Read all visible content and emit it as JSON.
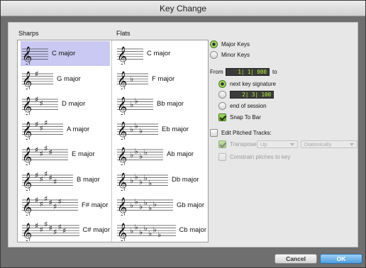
{
  "window": {
    "title": "Key Change"
  },
  "lists": {
    "sharps_header": "Sharps",
    "flats_header": "Flats",
    "sharps": [
      {
        "label": "C major",
        "accidentals": 0,
        "selected": true
      },
      {
        "label": "G major",
        "accidentals": 1
      },
      {
        "label": "D major",
        "accidentals": 2
      },
      {
        "label": "A major",
        "accidentals": 3
      },
      {
        "label": "E major",
        "accidentals": 4
      },
      {
        "label": "B major",
        "accidentals": 5
      },
      {
        "label": "F# major",
        "accidentals": 6
      },
      {
        "label": "C# major",
        "accidentals": 7
      }
    ],
    "flats": [
      {
        "label": "C major",
        "accidentals": 0
      },
      {
        "label": "F major",
        "accidentals": 1
      },
      {
        "label": "Bb major",
        "accidentals": 2
      },
      {
        "label": "Eb major",
        "accidentals": 3
      },
      {
        "label": "Ab major",
        "accidentals": 4
      },
      {
        "label": "Db major",
        "accidentals": 5
      },
      {
        "label": "Gb major",
        "accidentals": 6
      },
      {
        "label": "Cb major",
        "accidentals": 7
      }
    ]
  },
  "options": {
    "major_keys": "Major Keys",
    "minor_keys": "Minor Keys",
    "key_mode": "major",
    "from_label": "From",
    "from_value": "1| 1| 000",
    "to_label": "to",
    "next_key_signature": "next key signature",
    "to_value": "2| 3| 100",
    "end_of_session": "end of session",
    "to_mode": "next key signature",
    "snap_to_bar": "Snap To Bar",
    "snap_to_bar_checked": true,
    "edit_pitched_tracks": "Edit Pitched Tracks:",
    "edit_pitched_tracks_checked": false,
    "transpose": "Transpose",
    "transpose_checked": true,
    "transpose_direction": "Up",
    "transpose_mode": "Diatonically",
    "constrain_pitches": "Constrain pitches to key",
    "constrain_checked": false
  },
  "buttons": {
    "cancel": "Cancel",
    "ok": "OK"
  }
}
